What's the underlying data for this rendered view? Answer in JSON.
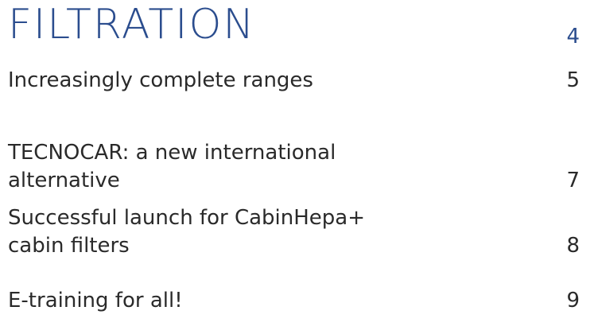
{
  "section": {
    "title": "FILTRATION",
    "page": "4"
  },
  "entries": [
    {
      "label": "Increasingly complete ranges",
      "page": "5"
    },
    {
      "label": "TECNOCAR: a new international alternative",
      "page": "7"
    },
    {
      "label_line1": "Successful launch for CabinHepa+",
      "label_line2": "cabin filters",
      "page": "8"
    },
    {
      "label": "E-training for all!",
      "page": "9"
    }
  ],
  "colors": {
    "accent": "#2b4d8e",
    "text": "#2a2a2a"
  }
}
